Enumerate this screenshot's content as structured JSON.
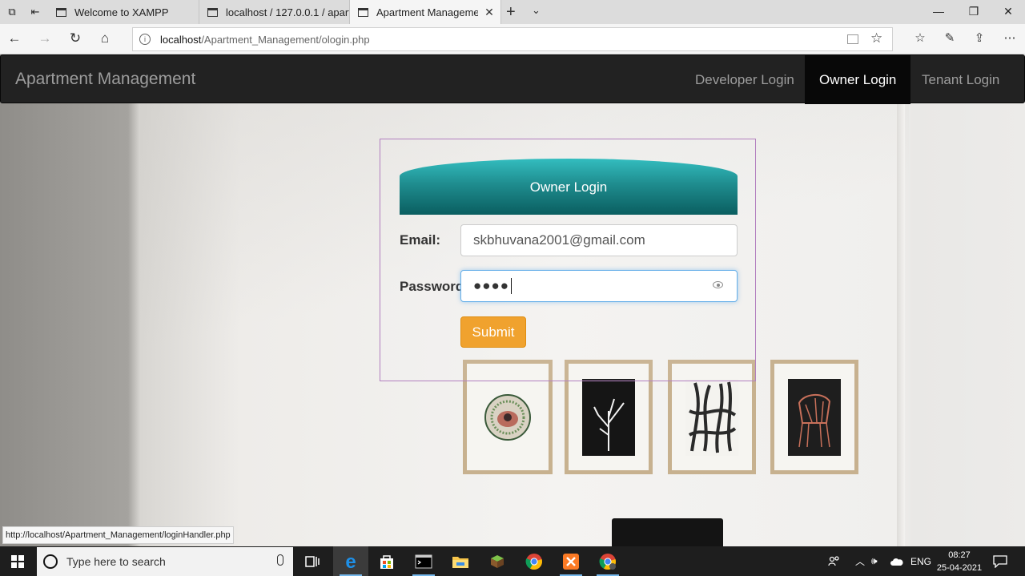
{
  "browser": {
    "tabs": [
      {
        "title": "Welcome to XAMPP",
        "active": false
      },
      {
        "title": "localhost / 127.0.0.1 / apartı",
        "active": false
      },
      {
        "title": "Apartment Managemer",
        "active": true
      }
    ],
    "url_host": "localhost",
    "url_path": "/Apartment_Management/ologin.php",
    "status_url": "http://localhost/Apartment_Management/loginHandler.php"
  },
  "app": {
    "brand": "Apartment Management",
    "nav_links": [
      {
        "label": "Developer Login",
        "active": false
      },
      {
        "label": "Owner Login",
        "active": true
      },
      {
        "label": "Tenant Login",
        "active": false
      }
    ]
  },
  "login": {
    "heading": "Owner Login",
    "email_label": "Email:",
    "email_value": "skbhuvana2001@gmail.com",
    "password_label": "Password",
    "password_mask": "●●●●",
    "submit_label": "Submit"
  },
  "taskbar": {
    "search_placeholder": "Type here to search",
    "language": "ENG",
    "time": "08:27",
    "date": "25-04-2021"
  },
  "colors": {
    "navbar_bg": "#222222",
    "nav_active_bg": "#080808",
    "heading_teal": "#1f8d8f",
    "submit_orange": "#f0a22e",
    "panel_border": "#b27fbf"
  }
}
